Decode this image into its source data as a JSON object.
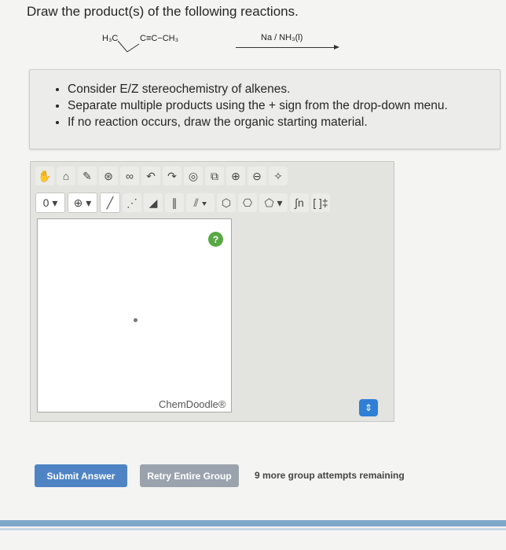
{
  "question": "Draw the product(s) of the following reactions.",
  "reaction": {
    "reactant_left": "H₃C",
    "reactant_right": "C≡C−CH₃",
    "reagent": "Na / NH₃(l)"
  },
  "instructions": [
    "Consider E/Z stereochemistry of alkenes.",
    "Separate multiple products using the + sign from the drop-down menu.",
    "If no reaction occurs, draw the organic starting material."
  ],
  "editor": {
    "row1": [
      "hand-icon",
      "eraser-icon",
      "pencil-icon",
      "ring-icon",
      "lasso-icon",
      "undo-icon",
      "redo-icon",
      "template-icon",
      "copy-icon",
      "zoom-in-icon",
      "zoom-out-icon",
      "clean-icon"
    ],
    "row2": {
      "charge_label": "0",
      "items": [
        "plus-charge-icon",
        "single-bond-icon",
        "dashed-bond-icon",
        "wedge-bond-icon",
        "double-bond-icon",
        "triple-bond-icon",
        "hexagon-icon",
        "ring-icon",
        "pentagon-icon",
        "function-icon",
        "bracket-icon"
      ],
      "function_label": "n",
      "bracket_label": "[ ]‡"
    },
    "help_label": "?",
    "watermark": "ChemDoodle®"
  },
  "stepper_icon": "⇕",
  "buttons": {
    "submit": "Submit Answer",
    "retry": "Retry Entire Group"
  },
  "remaining": "9 more group attempts remaining"
}
